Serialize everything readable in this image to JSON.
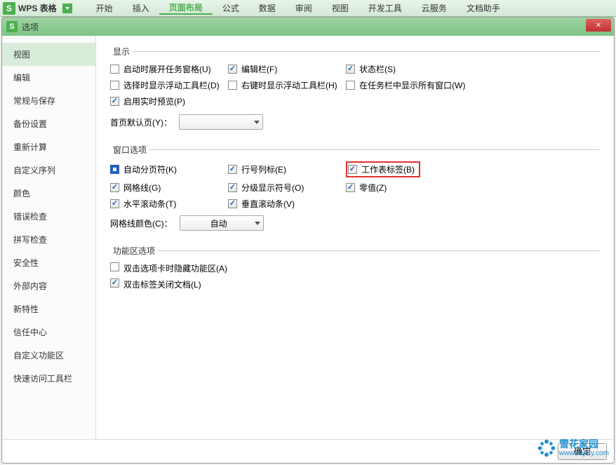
{
  "app": {
    "title": "WPS 表格"
  },
  "menu": {
    "items": [
      "开始",
      "插入",
      "页面布局",
      "公式",
      "数据",
      "审阅",
      "视图",
      "开发工具",
      "云服务",
      "文档助手"
    ],
    "active_index": 2
  },
  "dialog": {
    "title": "选项",
    "footer": {
      "ok": "确定"
    }
  },
  "sidebar": {
    "items": [
      "视图",
      "编辑",
      "常规与保存",
      "备份设置",
      "重新计算",
      "自定义序列",
      "颜色",
      "错误检查",
      "拼写检查",
      "安全性",
      "外部内容",
      "新特性",
      "信任中心",
      "自定义功能区",
      "快速访问工具栏"
    ],
    "selected_index": 0
  },
  "sections": {
    "display": {
      "legend": "显示",
      "startup_pane": {
        "label": "启动时展开任务窗格(U)",
        "checked": false
      },
      "edit_bar": {
        "label": "编辑栏(F)",
        "checked": true
      },
      "status_bar": {
        "label": "状态栏(S)",
        "checked": true
      },
      "float_toolbar_sel": {
        "label": "选择时显示浮动工具栏(D)",
        "checked": false
      },
      "float_toolbar_rclick": {
        "label": "右键时显示浮动工具栏(H)",
        "checked": false
      },
      "taskbar_windows": {
        "label": "在任务栏中显示所有窗口(W)",
        "checked": false
      },
      "live_preview": {
        "label": "启用实时预览(P)",
        "checked": true
      },
      "default_page_label": "首页默认页(Y)：",
      "default_page_value": ""
    },
    "window": {
      "legend": "窗口选项",
      "auto_page_break": {
        "label": "自动分页符(K)",
        "checked": true,
        "filled": true
      },
      "row_col_headers": {
        "label": "行号列标(E)",
        "checked": true
      },
      "sheet_tabs": {
        "label": "工作表标签(B)",
        "checked": true
      },
      "gridlines": {
        "label": "网格线(G)",
        "checked": true
      },
      "outline_symbols": {
        "label": "分级显示符号(O)",
        "checked": true
      },
      "zero_values": {
        "label": "零值(Z)",
        "checked": true
      },
      "h_scroll": {
        "label": "水平滚动条(T)",
        "checked": true
      },
      "v_scroll": {
        "label": "垂直滚动条(V)",
        "checked": true
      },
      "gridline_color_label": "网格线颜色(C)：",
      "gridline_color_value": "自动"
    },
    "ribbon": {
      "legend": "功能区选项",
      "dblclick_hide": {
        "label": "双击选项卡时隐藏功能区(A)",
        "checked": false
      },
      "dblclick_close": {
        "label": "双击标签关闭文档(L)",
        "checked": true
      }
    }
  },
  "watermark": {
    "main": "雪花家园",
    "sub": "www.xhjaty.com"
  }
}
